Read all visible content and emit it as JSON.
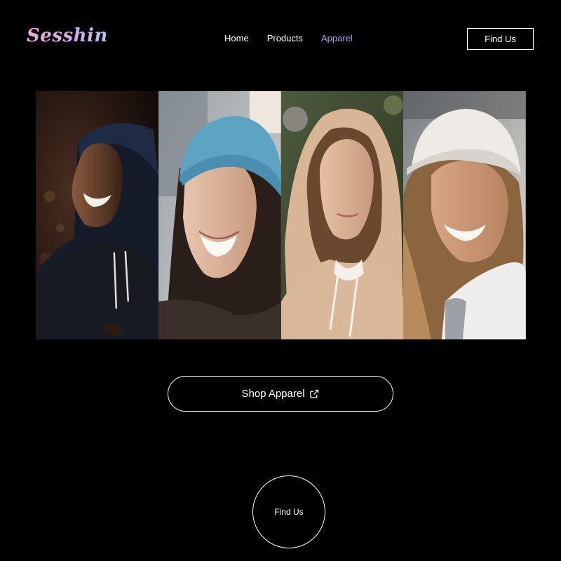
{
  "brand": {
    "logo_text": "Sesshin"
  },
  "nav": {
    "items": [
      {
        "label": "Home",
        "active": false
      },
      {
        "label": "Products",
        "active": false
      },
      {
        "label": "Apparel",
        "active": true
      }
    ],
    "active_color": "#b79bf2"
  },
  "header": {
    "find_us_label": "Find Us"
  },
  "gallery": {
    "photos": [
      {
        "subject": "man in dark navy hoodie, smiling"
      },
      {
        "subject": "woman in blue knit beanie, smiling"
      },
      {
        "subject": "woman in beige hoodie"
      },
      {
        "subject": "woman in white cap and white jacket, smiling"
      }
    ]
  },
  "cta": {
    "shop_label": "Shop Apparel",
    "shop_icon": "external-link-icon"
  },
  "footer_cta": {
    "find_us_label": "Find Us"
  },
  "colors": {
    "background": "#000000",
    "text": "#ffffff",
    "accent": "#b79bf2"
  }
}
